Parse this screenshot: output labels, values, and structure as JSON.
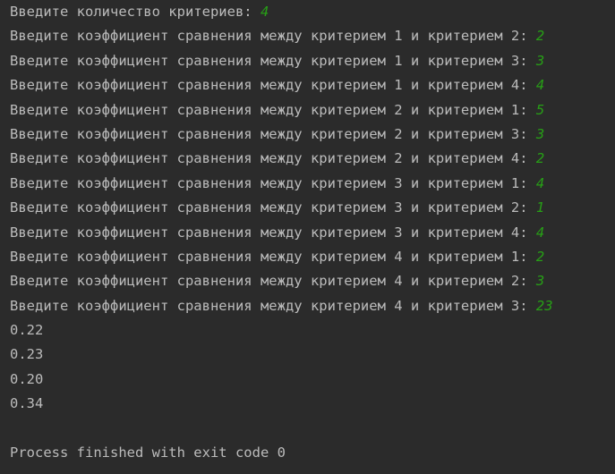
{
  "colors": {
    "background": "#2b2b2b",
    "text": "#bbbbbb",
    "user_input": "#279f16"
  },
  "console": {
    "prompts": [
      {
        "text": "Введите количество критериев: ",
        "input": "4"
      },
      {
        "text": "Введите коэффициент сравнения между критерием 1 и критерием 2: ",
        "input": "2"
      },
      {
        "text": "Введите коэффициент сравнения между критерием 1 и критерием 3: ",
        "input": "3"
      },
      {
        "text": "Введите коэффициент сравнения между критерием 1 и критерием 4: ",
        "input": "4"
      },
      {
        "text": "Введите коэффициент сравнения между критерием 2 и критерием 1: ",
        "input": "5"
      },
      {
        "text": "Введите коэффициент сравнения между критерием 2 и критерием 3: ",
        "input": "3"
      },
      {
        "text": "Введите коэффициент сравнения между критерием 2 и критерием 4: ",
        "input": "2"
      },
      {
        "text": "Введите коэффициент сравнения между критерием 3 и критерием 1: ",
        "input": "4"
      },
      {
        "text": "Введите коэффициент сравнения между критерием 3 и критерием 2: ",
        "input": "1"
      },
      {
        "text": "Введите коэффициент сравнения между критерием 3 и критерием 4: ",
        "input": "4"
      },
      {
        "text": "Введите коэффициент сравнения между критерием 4 и критерием 1: ",
        "input": "2"
      },
      {
        "text": "Введите коэффициент сравнения между критерием 4 и критерием 2: ",
        "input": "3"
      },
      {
        "text": "Введите коэффициент сравнения между критерием 4 и критерием 3: ",
        "input": "23"
      }
    ],
    "results": [
      "0.22",
      "0.23",
      "0.20",
      "0.34"
    ],
    "exit_message": "Process finished with exit code 0"
  }
}
